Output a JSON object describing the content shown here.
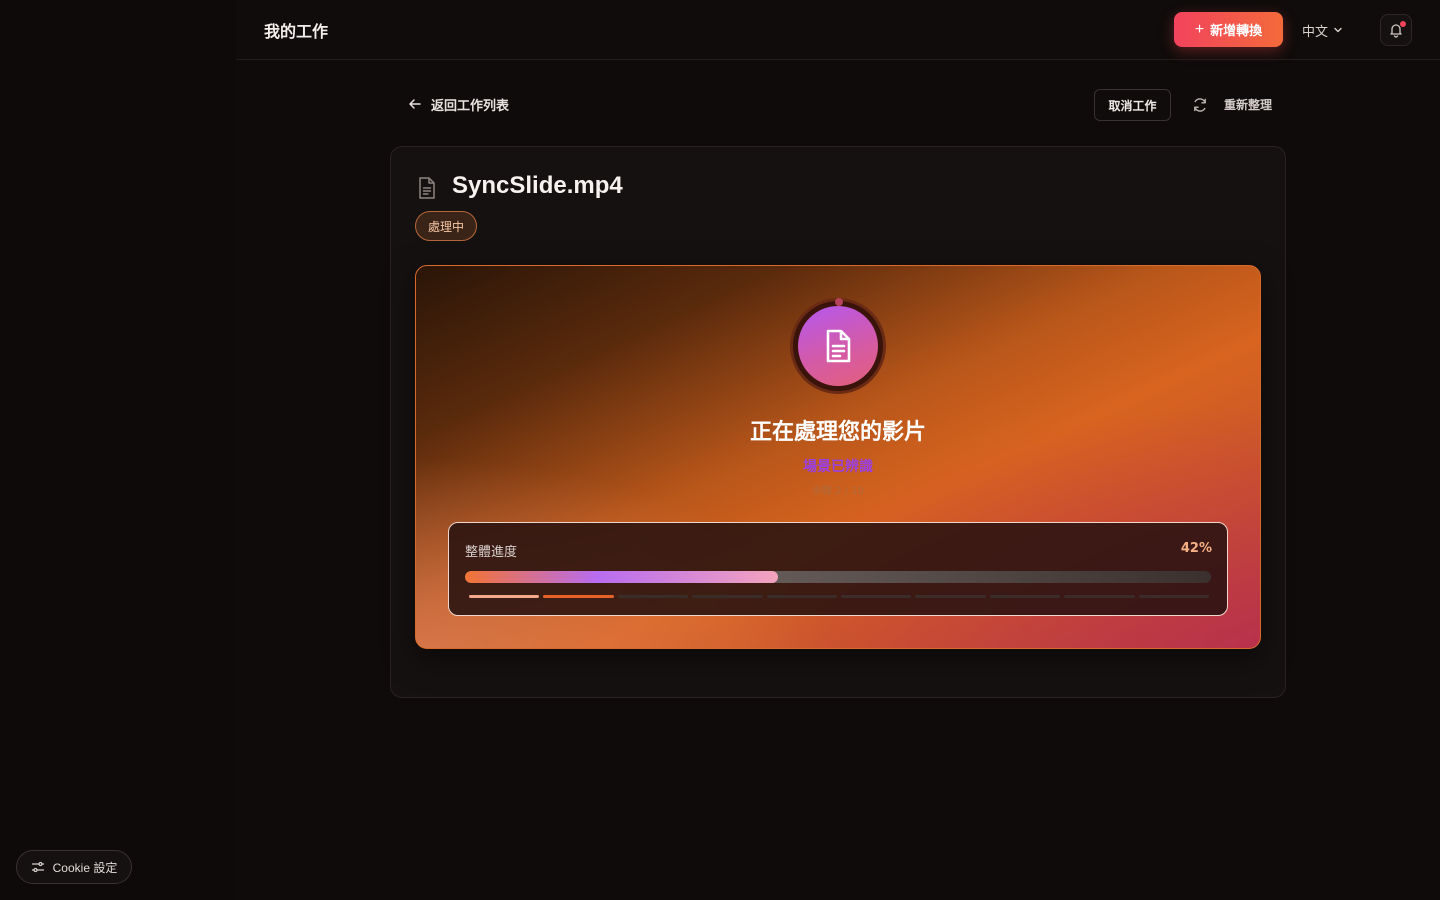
{
  "header": {
    "title": "我的工作",
    "new_button_label": "新增轉換",
    "language": "中文"
  },
  "nav": {
    "back_label": "返回工作列表",
    "cancel_label": "取消工作",
    "refresh_label": "重新整理"
  },
  "job": {
    "file_name": "SyncSlide.mp4",
    "status": "處理中"
  },
  "progress": {
    "title": "正在處理您的影片",
    "current_step": "場景已辨識",
    "step_detail": "步驟 2 / 10",
    "overall_label": "整體進度",
    "percent_label": "42%",
    "percent_value": 42,
    "segments_total": 10,
    "segments_done": 1,
    "segments_active": 1
  },
  "cookie": {
    "label": "Cookie 設定"
  },
  "colors": {
    "accent_start": "#f2435d",
    "accent_end": "#f46a3b",
    "background": "#0e0b0a",
    "step_text": "#9a3fe0"
  },
  "icons": {
    "new": "plus-icon",
    "language": "chevron-down-icon",
    "notifications": "bell-icon",
    "back": "arrow-left-icon",
    "refresh": "refresh-icon",
    "file": "file-text-icon",
    "cookie": "sliders-icon"
  }
}
